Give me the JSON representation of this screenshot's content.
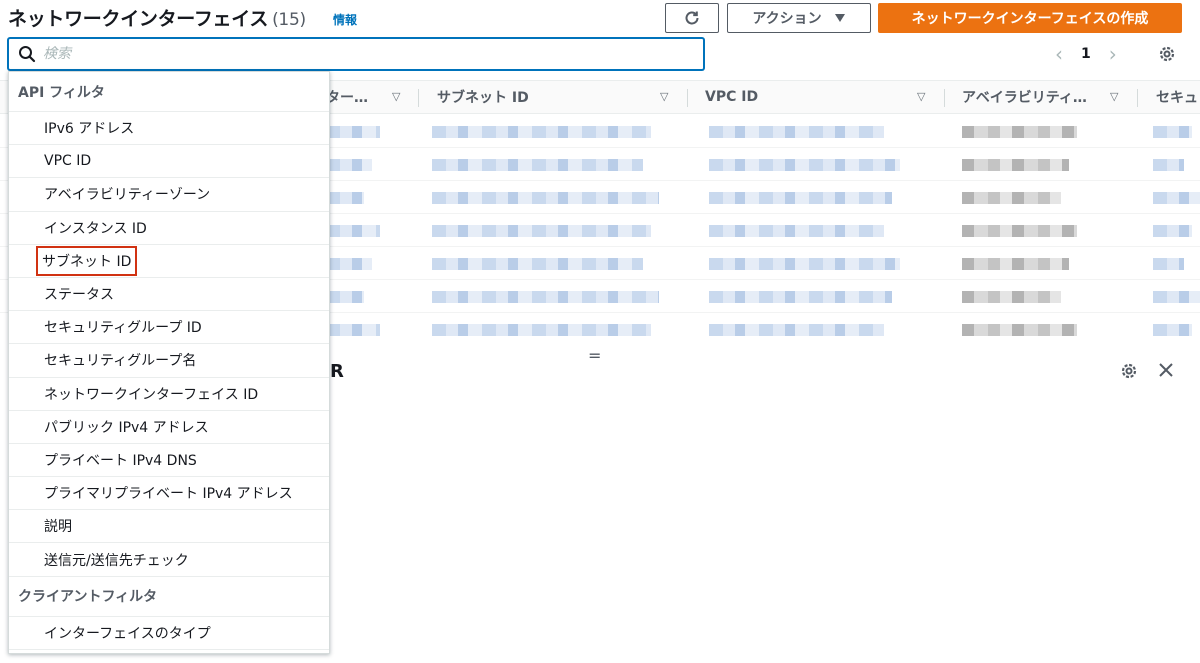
{
  "header": {
    "title": "ネットワークインターフェイス",
    "count": "(15)",
    "info_link": "情報",
    "actions_label": "アクション",
    "create_label": "ネットワークインターフェイスの作成"
  },
  "search": {
    "placeholder": "検索",
    "value": ""
  },
  "pagination": {
    "current_page": "1"
  },
  "table": {
    "columns": [
      {
        "label": "ター…"
      },
      {
        "label": "サブネット ID"
      },
      {
        "label": "VPC ID"
      },
      {
        "label": "アベイラビリティ…"
      },
      {
        "label": "セキュ"
      }
    ],
    "row_count": 7
  },
  "details_panel": {
    "title_fragment": "R"
  },
  "dropdown": {
    "api_filter_header": "API フィルタ",
    "api_filters": [
      "IPv6 アドレス",
      "VPC ID",
      "アベイラビリティーゾーン",
      "インスタンス ID",
      "サブネット ID",
      "ステータス",
      "セキュリティグループ ID",
      "セキュリティグループ名",
      "ネットワークインターフェイス ID",
      "パブリック IPv4 アドレス",
      "プライベート IPv4 DNS",
      "プライマリプライベート IPv4 アドレス",
      "説明",
      "送信元/送信先チェック"
    ],
    "highlighted_index": 4,
    "client_filter_header": "クライアントフィルタ",
    "client_filters": [
      "インターフェイスのタイプ"
    ]
  },
  "colors": {
    "accent": "#0073bb",
    "primary_button": "#ec7211",
    "highlight_border": "#d13212"
  }
}
